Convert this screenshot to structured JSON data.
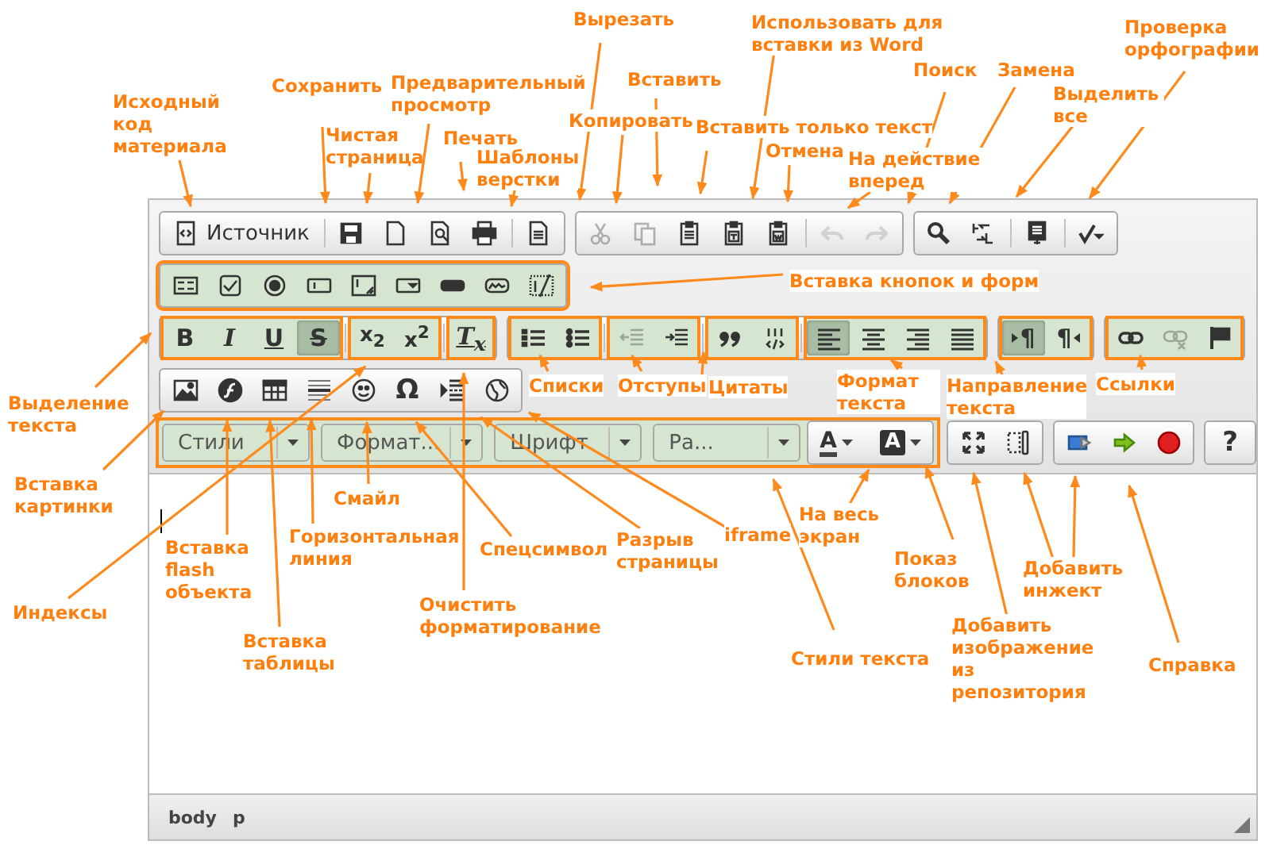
{
  "editor": {
    "toolbar": {
      "rows": [
        {
          "groups": [
            {
              "kind": "buttons",
              "highlighted": false,
              "segments": [
                {
                  "highlighted": false,
                  "buttons": [
                    {
                      "kind": "icon_text",
                      "label": "Источник",
                      "disabled": false
                    }
                  ]
                },
                {
                  "highlighted": false,
                  "buttons": [
                    {
                      "kind": "icon",
                      "disabled": false
                    },
                    {
                      "kind": "icon",
                      "disabled": false
                    },
                    {
                      "kind": "icon",
                      "disabled": false
                    },
                    {
                      "kind": "icon",
                      "disabled": false
                    }
                  ]
                },
                {
                  "highlighted": false,
                  "buttons": [
                    {
                      "kind": "icon",
                      "disabled": false
                    }
                  ]
                }
              ]
            },
            {
              "kind": "buttons",
              "highlighted": false,
              "segments": [
                {
                  "highlighted": false,
                  "buttons": [
                    {
                      "kind": "icon",
                      "disabled": true
                    },
                    {
                      "kind": "icon",
                      "disabled": true
                    },
                    {
                      "kind": "icon",
                      "disabled": false
                    },
                    {
                      "kind": "icon",
                      "disabled": false
                    },
                    {
                      "kind": "icon",
                      "disabled": false
                    }
                  ]
                },
                {
                  "highlighted": false,
                  "buttons": [
                    {
                      "kind": "icon",
                      "disabled": true
                    },
                    {
                      "kind": "icon",
                      "disabled": true
                    }
                  ]
                }
              ]
            },
            {
              "kind": "buttons",
              "highlighted": false,
              "segments": [
                {
                  "highlighted": false,
                  "buttons": [
                    {
                      "kind": "icon",
                      "disabled": false
                    },
                    {
                      "kind": "icon",
                      "disabled": false
                    }
                  ]
                },
                {
                  "highlighted": false,
                  "buttons": [
                    {
                      "kind": "icon",
                      "disabled": false
                    }
                  ]
                },
                {
                  "highlighted": false,
                  "buttons": [
                    {
                      "kind": "icon",
                      "disabled": false
                    }
                  ]
                }
              ]
            }
          ]
        },
        {
          "groups": [
            {
              "kind": "buttons",
              "highlighted": true,
              "segments": [
                {
                  "highlighted": false,
                  "buttons": [
                    {
                      "kind": "icon",
                      "disabled": false
                    },
                    {
                      "kind": "icon",
                      "disabled": false
                    },
                    {
                      "kind": "icon",
                      "disabled": false
                    },
                    {
                      "kind": "icon",
                      "disabled": false
                    },
                    {
                      "kind": "icon",
                      "disabled": false
                    },
                    {
                      "kind": "icon",
                      "disabled": false
                    },
                    {
                      "kind": "icon",
                      "disabled": false
                    },
                    {
                      "kind": "icon",
                      "disabled": false
                    },
                    {
                      "kind": "icon",
                      "disabled": false
                    }
                  ]
                }
              ]
            }
          ]
        },
        {
          "groups": [
            {
              "kind": "buttons",
              "highlighted": false,
              "segments": [
                {
                  "highlighted": true,
                  "buttons": [
                    {
                      "kind": "text",
                      "label": "B",
                      "disabled": false,
                      "selected": false
                    },
                    {
                      "kind": "text",
                      "label": "I",
                      "disabled": false,
                      "selected": false
                    },
                    {
                      "kind": "text",
                      "label": "U",
                      "disabled": false,
                      "selected": false
                    },
                    {
                      "kind": "text",
                      "label": "S",
                      "disabled": false,
                      "selected": true
                    }
                  ]
                },
                {
                  "highlighted": true,
                  "buttons": [
                    {
                      "kind": "text",
                      "label": "x$_{2}$",
                      "disabled": false
                    },
                    {
                      "kind": "text",
                      "label": "x$^{2}$",
                      "disabled": false
                    }
                  ]
                },
                {
                  "highlighted": true,
                  "buttons": [
                    {
                      "kind": "text",
                      "label": "T$_{x}$",
                      "disabled": false
                    }
                  ]
                }
              ]
            },
            {
              "kind": "buttons",
              "highlighted": false,
              "segments": [
                {
                  "highlighted": true,
                  "buttons": [
                    {
                      "kind": "icon",
                      "disabled": false
                    },
                    {
                      "kind": "icon",
                      "disabled": false
                    }
                  ]
                },
                {
                  "highlighted": true,
                  "buttons": [
                    {
                      "kind": "icon",
                      "disabled": true
                    },
                    {
                      "kind": "icon",
                      "disabled": false
                    }
                  ]
                },
                {
                  "highlighted": true,
                  "buttons": [
                    {
                      "kind": "icon",
                      "disabled": false
                    },
                    {
                      "kind": "icon",
                      "disabled": false
                    }
                  ]
                },
                {
                  "highlighted": true,
                  "buttons": [
                    {
                      "kind": "icon",
                      "disabled": false,
                      "selected": true
                    },
                    {
                      "kind": "icon",
                      "disabled": false,
                      "selected": false
                    },
                    {
                      "kind": "icon",
                      "disabled": false,
                      "selected": false
                    },
                    {
                      "kind": "icon",
                      "disabled": false,
                      "selected": false
                    }
                  ]
                }
              ]
            },
            {
              "kind": "buttons",
              "highlighted": false,
              "segments": [
                {
                  "highlighted": true,
                  "buttons": [
                    {
                      "kind": "text",
                      "label": "¶",
                      "disabled": false,
                      "selected": true
                    },
                    {
                      "kind": "text",
                      "label": "¶",
                      "disabled": false,
                      "selected": false
                    }
                  ]
                }
              ]
            },
            {
              "kind": "buttons",
              "highlighted": false,
              "segments": [
                {
                  "highlighted": true,
                  "buttons": [
                    {
                      "kind": "icon",
                      "disabled": false
                    },
                    {
                      "kind": "icon",
                      "disabled": true
                    },
                    {
                      "kind": "icon",
                      "disabled": false
                    }
                  ]
                }
              ]
            }
          ]
        },
        {
          "groups": [
            {
              "kind": "buttons",
              "highlighted": false,
              "segments": [
                {
                  "highlighted": false,
                  "buttons": [
                    {
                      "kind": "icon",
                      "disabled": false
                    },
                    {
                      "kind": "icon",
                      "disabled": false
                    },
                    {
                      "kind": "icon",
                      "disabled": false
                    },
                    {
                      "kind": "icon",
                      "disabled": false
                    },
                    {
                      "kind": "icon",
                      "disabled": false
                    },
                    {
                      "kind": "text",
                      "label": "Ω",
                      "disabled": false
                    },
                    {
                      "kind": "icon",
                      "disabled": false
                    },
                    {
                      "kind": "icon",
                      "disabled": false
                    }
                  ]
                }
              ]
            }
          ]
        },
        {
          "groups": [
            {
              "kind": "combos",
              "highlighted": true,
              "segments": [
                {
                  "highlighted": false,
                  "buttons": [
                    {
                      "kind": "combo",
                      "label": "Стили",
                      "disabled": false
                    },
                    {
                      "kind": "combo",
                      "label": "Формат...",
                      "disabled": false
                    },
                    {
                      "kind": "combo",
                      "label": "Шрифт",
                      "disabled": false
                    },
                    {
                      "kind": "combo",
                      "label": "Ра...",
                      "disabled": false
                    }
                  ]
                },
                {
                  "highlighted": false,
                  "buttons": [
                    {
                      "kind": "color",
                      "label": "A",
                      "disabled": false
                    },
                    {
                      "kind": "color",
                      "label": "A",
                      "disabled": false
                    }
                  ]
                }
              ]
            },
            {
              "kind": "buttons",
              "highlighted": false,
              "segments": [
                {
                  "highlighted": false,
                  "buttons": [
                    {
                      "kind": "icon",
                      "disabled": false
                    },
                    {
                      "kind": "icon",
                      "disabled": false
                    }
                  ]
                }
              ]
            },
            {
              "kind": "buttons",
              "highlighted": false,
              "segments": [
                {
                  "highlighted": false,
                  "buttons": [
                    {
                      "kind": "icon",
                      "disabled": false
                    },
                    {
                      "kind": "icon",
                      "disabled": false
                    },
                    {
                      "kind": "icon",
                      "disabled": false
                    }
                  ]
                }
              ]
            },
            {
              "kind": "buttons",
              "highlighted": false,
              "segments": [
                {
                  "highlighted": false,
                  "buttons": [
                    {
                      "kind": "text",
                      "label": "?",
                      "disabled": false
                    }
                  ]
                }
              ]
            }
          ]
        }
      ]
    },
    "status_bar": {
      "path": [
        "body",
        "p"
      ]
    }
  },
  "annotations": [
    {
      "text": "Вырезать"
    },
    {
      "text": "Использовать для вставки из Word"
    },
    {
      "text": "Проверка орфографии"
    },
    {
      "text": "Исходный код материала"
    },
    {
      "text": "Сохранить"
    },
    {
      "text": "Предварительный просмотр"
    },
    {
      "text": "Вставить"
    },
    {
      "text": "Поиск"
    },
    {
      "text": "Замена"
    },
    {
      "text": "Выделить все"
    },
    {
      "text": "Копировать"
    },
    {
      "text": "Вставить только текст"
    },
    {
      "text": "Чистая страница"
    },
    {
      "text": "Печать"
    },
    {
      "text": "Шаблоны верстки"
    },
    {
      "text": "Отмена"
    },
    {
      "text": "На действие вперед"
    },
    {
      "text": "Вставка кнопок и форм"
    },
    {
      "text": "Списки"
    },
    {
      "text": "Отступы"
    },
    {
      "text": "Цитаты"
    },
    {
      "text": "Формат текста"
    },
    {
      "text": "Направление текста"
    },
    {
      "text": "Ссылки"
    },
    {
      "text": "Выделение текста"
    },
    {
      "text": "Вставка картинки"
    },
    {
      "text": "Смайл"
    },
    {
      "text": "Вставка flash объекта"
    },
    {
      "text": "Горизонтальная линия"
    },
    {
      "text": "Спецсимвол"
    },
    {
      "text": "Разрыв страницы"
    },
    {
      "text": "iframe"
    },
    {
      "text": "На весь экран"
    },
    {
      "text": "Показ блоков"
    },
    {
      "text": "Добавить инжект"
    },
    {
      "text": "Индексы"
    },
    {
      "text": "Вставка таблицы"
    },
    {
      "text": "Очистить форматирование"
    },
    {
      "text": "Стили текста"
    },
    {
      "text": "Добавить изображение из репозитория"
    },
    {
      "text": "Справка"
    }
  ]
}
